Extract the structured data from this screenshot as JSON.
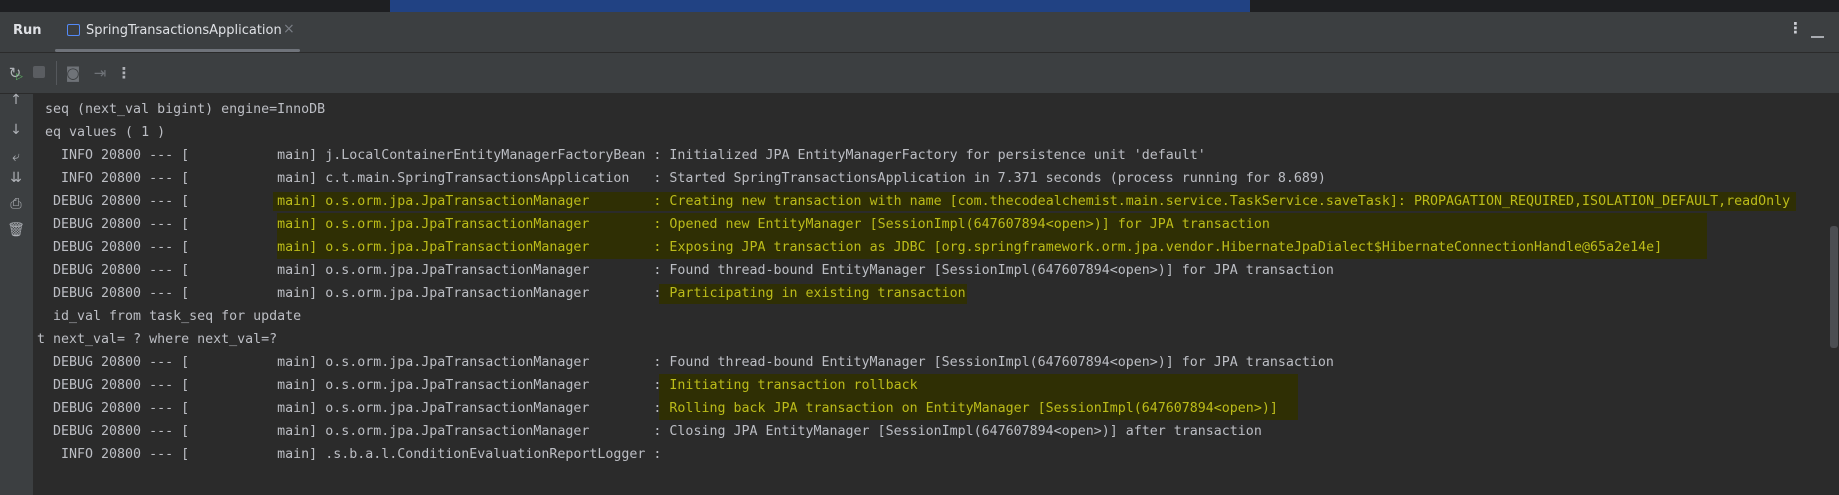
{
  "header": {
    "panel_title": "Run",
    "tab_label": "SpringTransactionsApplication",
    "tab_close": "×"
  },
  "icons": [
    "rerun-icon",
    "stop-icon",
    "camera-icon",
    "exit-icon",
    "more-icon",
    "scroll-up-icon",
    "scroll-down-icon",
    "soft-wrap-icon",
    "scroll-to-end-icon",
    "print-icon",
    "trash-icon",
    "options-icon",
    "minimize-icon"
  ],
  "colors": {
    "highlight_bg": "#2f2f04",
    "highlight_text": "#bcbc1a",
    "text": "#bcbec4",
    "console_bg": "#2b2b2b"
  },
  "console": {
    "lines": [
      {
        "text": "seq (next_val bigint) engine=InnoDB"
      },
      {
        "text": "eq values ( 1 )"
      },
      {
        "text": "  INFO 20800 --- [           main] j.LocalContainerEntityManagerFactoryBean : Initialized JPA EntityManagerFactory for persistence unit 'default'"
      },
      {
        "text": "  INFO 20800 --- [           main] c.t.main.SpringTransactionsApplication   : Started SpringTransactionsApplication in 7.371 seconds (process running for 8.689)"
      },
      {
        "text": " DEBUG 20800 --- [           ",
        "highlight": "main] o.s.orm.jpa.JpaTransactionManager        : Creating new transaction with name [com.thecodealchemist.main.service.TaskService.saveTask]: PROPAGATION_REQUIRED,ISOLATION_DEFAULT,readOnly"
      },
      {
        "text": " DEBUG 20800 --- [           ",
        "highlight": "main] o.s.orm.jpa.JpaTransactionManager        : Opened new EntityManager [SessionImpl(647607894<open>)] for JPA transaction"
      },
      {
        "text": " DEBUG 20800 --- [           ",
        "highlight": "main] o.s.orm.jpa.JpaTransactionManager        : Exposing JPA transaction as JDBC [org.springframework.orm.jpa.vendor.HibernateJpaDialect$HibernateConnectionHandle@65a2e14e]"
      },
      {
        "text": " DEBUG 20800 --- [           main] o.s.orm.jpa.JpaTransactionManager        : Found thread-bound EntityManager [SessionImpl(647607894<open>)] for JPA transaction"
      },
      {
        "text": " DEBUG 20800 --- [           main] o.s.orm.jpa.JpaTransactionManager        : ",
        "highlight": "Participating in existing transaction"
      },
      {
        "text": " id_val from task_seq for update"
      },
      {
        "text": "t next_val= ? where next_val=?"
      },
      {
        "text": " DEBUG 20800 --- [           main] o.s.orm.jpa.JpaTransactionManager        : Found thread-bound EntityManager [SessionImpl(647607894<open>)] for JPA transaction"
      },
      {
        "text": " DEBUG 20800 --- [           main] o.s.orm.jpa.JpaTransactionManager        : ",
        "highlight": "Initiating transaction rollback"
      },
      {
        "text": " DEBUG 20800 --- [           main] o.s.orm.jpa.JpaTransactionManager        : ",
        "highlight": "Rolling back JPA transaction on EntityManager [SessionImpl(647607894<open>)]"
      },
      {
        "text": " DEBUG 20800 --- [           main] o.s.orm.jpa.JpaTransactionManager        : Closing JPA EntityManager [SessionImpl(647607894<open>)] after transaction"
      },
      {
        "text": "  INFO 20800 --- [           main] .s.b.a.l.ConditionEvaluationReportLogger : "
      }
    ]
  }
}
